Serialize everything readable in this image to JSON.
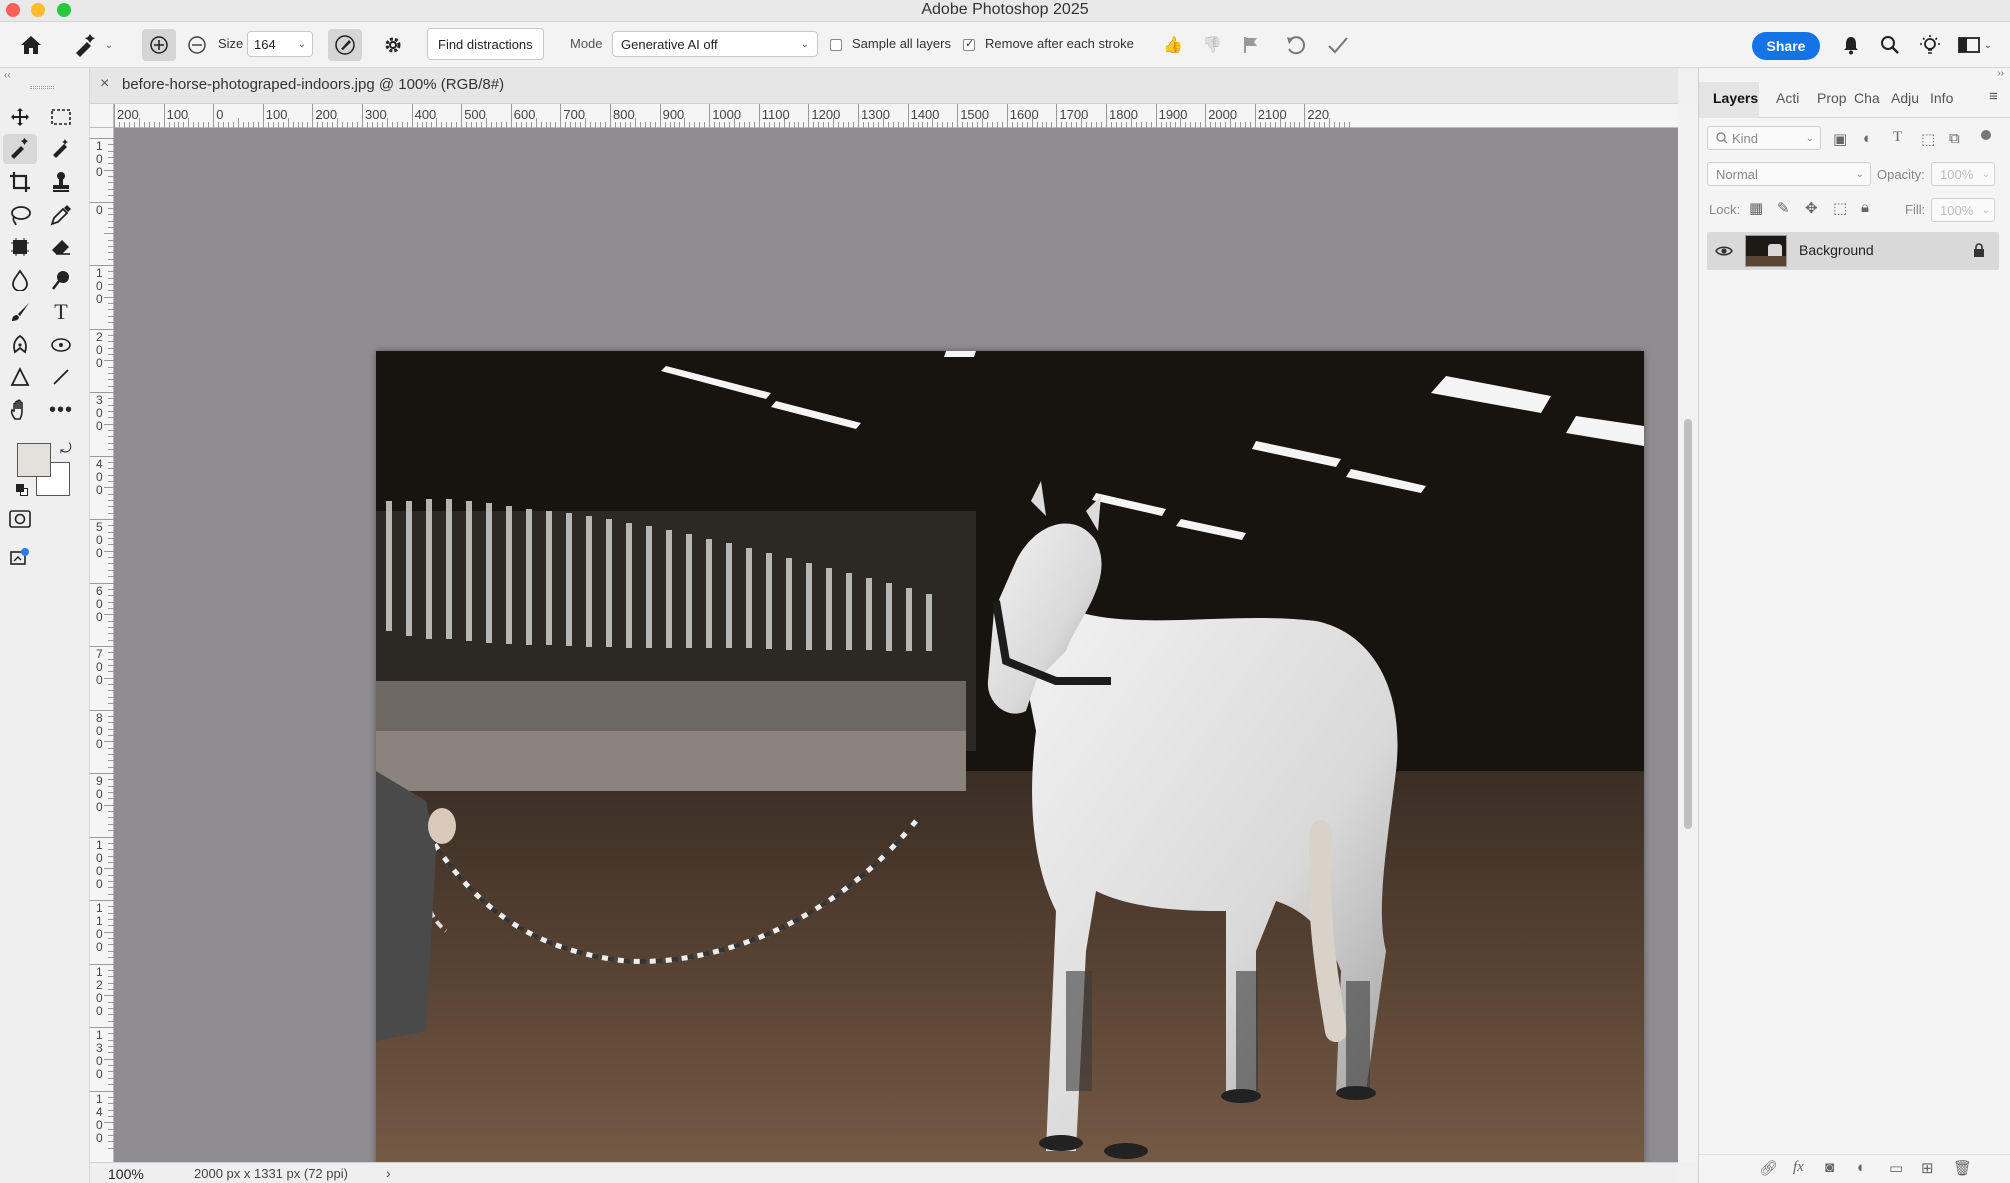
{
  "window": {
    "title": "Adobe Photoshop 2025",
    "traffic_colors": [
      "#fe5f57",
      "#febc2e",
      "#28c840"
    ]
  },
  "options_bar": {
    "size_label": "Size",
    "size_value": "164",
    "find_distractions_label": "Find distractions",
    "mode_label": "Mode",
    "mode_value": "Generative AI off",
    "sample_all_layers_label": "Sample all layers",
    "sample_all_layers_checked": false,
    "remove_after_stroke_label": "Remove after each stroke",
    "remove_after_stroke_checked": true,
    "share_label": "Share",
    "accent_color": "#1473e6"
  },
  "document": {
    "tab_title": "before-horse-photograped-indoors.jpg @ 100% (RGB/8#)",
    "close_glyph": "×"
  },
  "rulers": {
    "top_labels": [
      "200",
      "100",
      "0",
      "100",
      "200",
      "300",
      "400",
      "500",
      "600",
      "700",
      "800",
      "900",
      "1000",
      "1100",
      "1200",
      "1300",
      "1400",
      "1500",
      "1600",
      "1700",
      "1800",
      "1900",
      "2000",
      "2100",
      "220"
    ],
    "left_labels": [
      "100",
      "0",
      "100",
      "200",
      "300",
      "400",
      "500",
      "600",
      "700",
      "800",
      "900",
      "1000",
      "1100",
      "1200",
      "1300",
      "1400"
    ]
  },
  "status": {
    "zoom": "100%",
    "doc_info": "2000 px x 1331 px (72 ppi)"
  },
  "panel": {
    "tabs": [
      "Layers",
      "Acti",
      "Prop",
      "Cha",
      "Adju",
      "Info"
    ],
    "kind_placeholder": "Kind",
    "blend_mode": "Normal",
    "opacity_label": "Opacity:",
    "opacity_value": "100%",
    "lock_label": "Lock:",
    "fill_label": "Fill:",
    "fill_value": "100%",
    "layers": [
      {
        "name": "Background",
        "visible": true,
        "locked": true
      }
    ]
  },
  "tools": {
    "icons": [
      "move-icon",
      "marquee-icon",
      "remove-tool-icon",
      "healing-brush-icon",
      "crop-icon",
      "stamp-icon",
      "lasso-icon",
      "eyedropper-icon",
      "frame-icon",
      "eraser-icon",
      "blur-icon",
      "dodge-icon",
      "brush-icon",
      "type-icon",
      "pen-icon",
      "path-selection-icon",
      "shape-icon",
      "line-icon",
      "hand-icon",
      "more-icon"
    ],
    "foreground_color": "#e3e1dc",
    "background_color": "#ffffff"
  }
}
